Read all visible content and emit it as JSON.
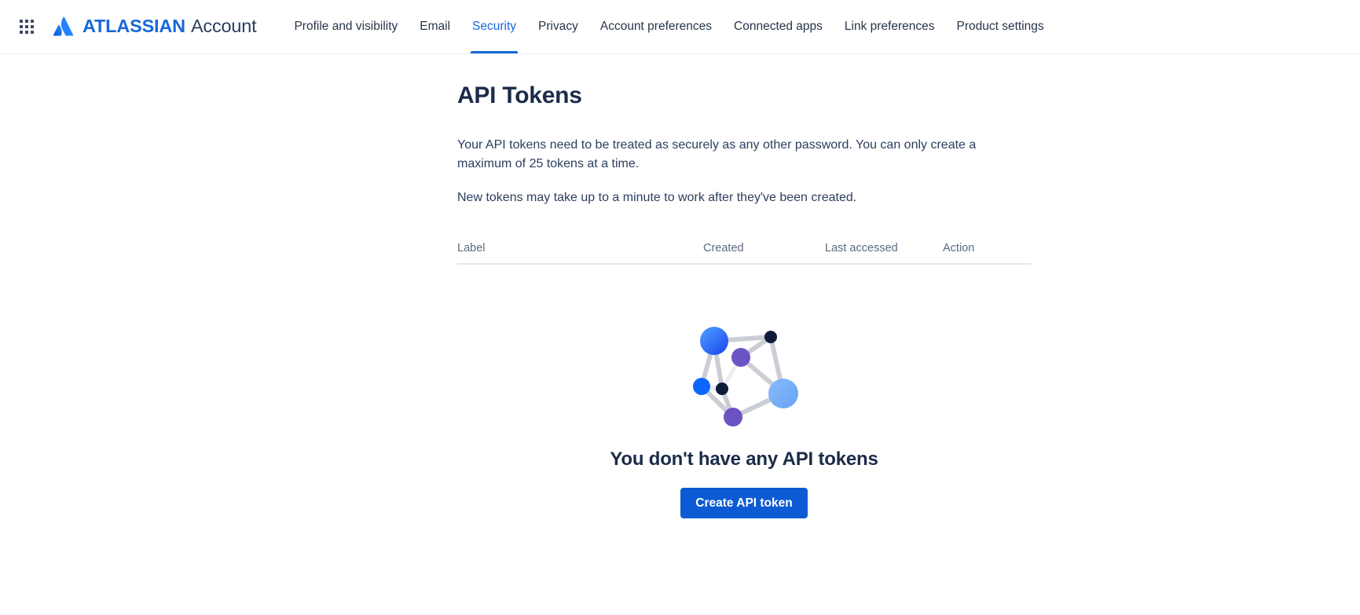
{
  "header": {
    "app_switcher_icon": "grid-apps-icon",
    "brand": {
      "logo_icon": "atlassian-logo-icon",
      "name_bold": "ATLASSIAN",
      "name_light": "Account"
    },
    "nav": [
      {
        "label": "Profile and visibility",
        "active": false
      },
      {
        "label": "Email",
        "active": false
      },
      {
        "label": "Security",
        "active": true
      },
      {
        "label": "Privacy",
        "active": false
      },
      {
        "label": "Account preferences",
        "active": false
      },
      {
        "label": "Connected apps",
        "active": false
      },
      {
        "label": "Link preferences",
        "active": false
      },
      {
        "label": "Product settings",
        "active": false
      }
    ]
  },
  "main": {
    "title": "API Tokens",
    "paragraph_1": "Your API tokens need to be treated as securely as any other password. You can only create a maximum of 25 tokens at a time.",
    "paragraph_2": "New tokens may take up to a minute to work after they've been created.",
    "table": {
      "columns": {
        "label": "Label",
        "created": "Created",
        "last_accessed": "Last accessed",
        "action": "Action"
      },
      "rows": []
    },
    "empty_state": {
      "illustration_icon": "network-nodes-illustration",
      "title": "You don't have any API tokens",
      "create_button": "Create API token"
    }
  },
  "colors": {
    "brand_blue": "#1868db",
    "button_blue": "#0c5bd4",
    "text_dark": "#1b2b49",
    "text_body": "#2c3e5d",
    "text_muted": "#5d6b82",
    "divider": "#e4e6ea",
    "node_bright_blue": "#0b66ff",
    "node_light_blue": "#6aa5f5",
    "node_purple": "#6b53c4",
    "node_navy": "#101b3c",
    "edge_gray": "#c9ccd3"
  }
}
